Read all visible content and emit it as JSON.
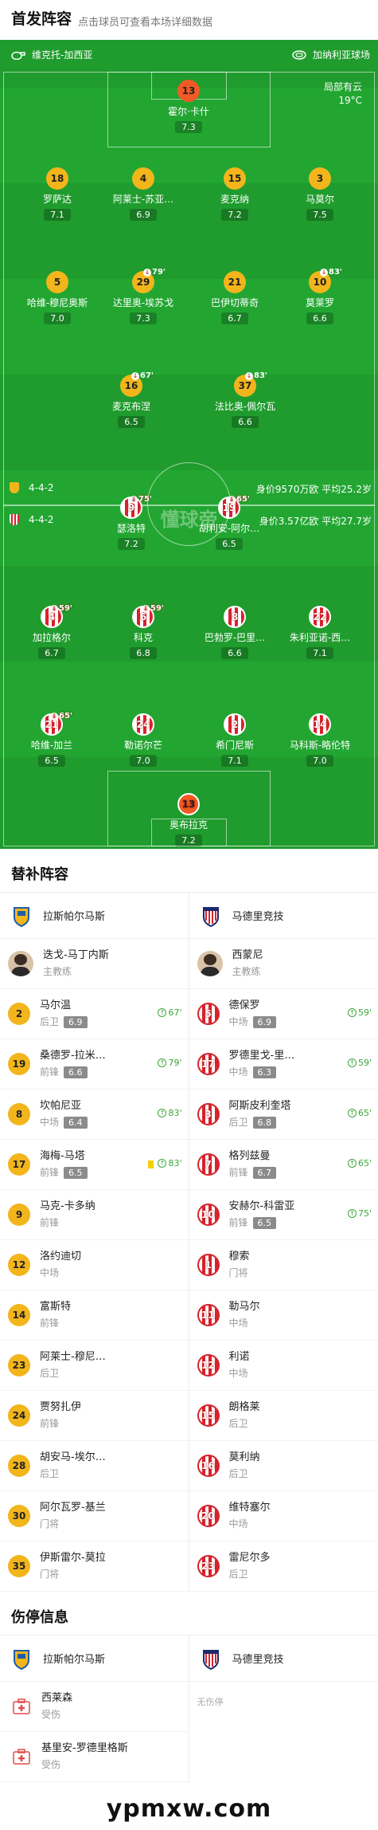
{
  "header": {
    "title": "首发阵容",
    "subtitle": "点击球员可查看本场详细数据"
  },
  "venue": {
    "home_team": "维克托-加西亚",
    "stadium": "加纳利亚球场",
    "weather": "局部有云",
    "temperature": "19°C"
  },
  "watermark": "懂球帝",
  "home_info": {
    "formation": "4-4-2",
    "value": "身价9570万欧",
    "avg_age": "平均25.2岁"
  },
  "away_info": {
    "formation": "4-4-2",
    "value": "身价3.57亿欧",
    "avg_age": "平均27.7岁"
  },
  "home_players": [
    {
      "num": "13",
      "name": "霍尔·卡什",
      "rating": "7.3"
    },
    {
      "num": "18",
      "name": "罗萨达",
      "rating": "7.1"
    },
    {
      "num": "4",
      "name": "阿莱士-苏亚…",
      "rating": "6.9"
    },
    {
      "num": "15",
      "name": "麦克纳",
      "rating": "7.2"
    },
    {
      "num": "3",
      "name": "马莫尔",
      "rating": "7.5"
    },
    {
      "num": "5",
      "name": "哈维-穆尼奥斯",
      "rating": "7.0"
    },
    {
      "num": "29",
      "name": "达里奥-埃苏戈",
      "rating": "7.3",
      "sub": "79'"
    },
    {
      "num": "21",
      "name": "巴伊切蒂奇",
      "rating": "6.7"
    },
    {
      "num": "10",
      "name": "莫莱罗",
      "rating": "6.6",
      "sub": "83'"
    },
    {
      "num": "16",
      "name": "麦克布涅",
      "rating": "6.5",
      "sub": "67'"
    },
    {
      "num": "37",
      "name": "法比奥-佩尔瓦",
      "rating": "6.6",
      "sub": "83'"
    }
  ],
  "away_players": [
    {
      "num": "9",
      "name": "瑟洛特",
      "rating": "7.2",
      "sub": "75'"
    },
    {
      "num": "19",
      "name": "胡利安-阿尔…",
      "rating": "6.5",
      "sub": "65'"
    },
    {
      "num": "4",
      "name": "加拉格尔",
      "rating": "6.7",
      "sub": "59'"
    },
    {
      "num": "6",
      "name": "科克",
      "rating": "6.8",
      "sub": "59'"
    },
    {
      "num": "8",
      "name": "巴勃罗-巴里…",
      "rating": "6.6"
    },
    {
      "num": "22",
      "name": "朱利亚诺-西…",
      "rating": "7.1"
    },
    {
      "num": "21",
      "name": "哈维-加兰",
      "rating": "6.5",
      "sub": "65'"
    },
    {
      "num": "24",
      "name": "勒诺尔芒",
      "rating": "7.0"
    },
    {
      "num": "2",
      "name": "希门尼斯",
      "rating": "7.1"
    },
    {
      "num": "14",
      "name": "马科斯-略伦特",
      "rating": "7.0"
    },
    {
      "num": "13",
      "name": "奥布拉克",
      "rating": "7.2"
    }
  ],
  "subs": {
    "title": "替补阵容",
    "home_team": "拉斯帕尔马斯",
    "away_team": "马德里竞技",
    "home_coach": {
      "name": "迭戈-马丁内斯",
      "role": "主教练"
    },
    "away_coach": {
      "name": "西蒙尼",
      "role": "主教练"
    },
    "home": [
      {
        "num": "2",
        "name": "马尔温",
        "pos": "后卫",
        "rating": "6.9",
        "in": "67'"
      },
      {
        "num": "19",
        "name": "桑德罗-拉米…",
        "pos": "前锋",
        "rating": "6.6",
        "in": "79'"
      },
      {
        "num": "8",
        "name": "坎帕尼亚",
        "pos": "中场",
        "rating": "6.4",
        "in": "83'"
      },
      {
        "num": "17",
        "name": "海梅-马塔",
        "pos": "前锋",
        "rating": "6.5",
        "in": "83'",
        "card": true
      },
      {
        "num": "9",
        "name": "马克-卡多纳",
        "pos": "前锋"
      },
      {
        "num": "12",
        "name": "洛约迪切",
        "pos": "中场"
      },
      {
        "num": "14",
        "name": "富斯特",
        "pos": "前锋"
      },
      {
        "num": "23",
        "name": "阿莱士-穆尼…",
        "pos": "后卫"
      },
      {
        "num": "24",
        "name": "贾努扎伊",
        "pos": "前锋"
      },
      {
        "num": "28",
        "name": "胡安马-埃尔…",
        "pos": "后卫"
      },
      {
        "num": "30",
        "name": "阿尔瓦罗-基兰",
        "pos": "门将"
      },
      {
        "num": "35",
        "name": "伊斯雷尔-莫拉",
        "pos": "门将"
      }
    ],
    "away": [
      {
        "num": "5",
        "name": "德保罗",
        "pos": "中场",
        "rating": "6.9",
        "in": "59'"
      },
      {
        "num": "17",
        "name": "罗德里戈-里…",
        "pos": "中场",
        "rating": "6.3",
        "in": "59'"
      },
      {
        "num": "3",
        "name": "阿斯皮利奎塔",
        "pos": "后卫",
        "rating": "6.8",
        "in": "65'"
      },
      {
        "num": "7",
        "name": "格列兹曼",
        "pos": "前锋",
        "rating": "6.7",
        "in": "65'"
      },
      {
        "num": "10",
        "name": "安赫尔-科雷亚",
        "pos": "前锋",
        "rating": "6.5",
        "in": "75'"
      },
      {
        "num": "1",
        "name": "穆索",
        "pos": "门将"
      },
      {
        "num": "11",
        "name": "勒马尔",
        "pos": "中场"
      },
      {
        "num": "12",
        "name": "利诺",
        "pos": "中场"
      },
      {
        "num": "15",
        "name": "朗格莱",
        "pos": "后卫"
      },
      {
        "num": "16",
        "name": "莫利纳",
        "pos": "后卫"
      },
      {
        "num": "20",
        "name": "维特塞尔",
        "pos": "中场"
      },
      {
        "num": "23",
        "name": "雷尼尔多",
        "pos": "后卫"
      }
    ]
  },
  "injuries": {
    "title": "伤停信息",
    "home_team": "拉斯帕尔马斯",
    "away_team": "马德里竞技",
    "home": [
      {
        "name": "西莱森",
        "status": "受伤"
      },
      {
        "name": "基里安-罗德里格斯",
        "status": "受伤"
      }
    ],
    "away_none": "无伤停"
  },
  "site_watermark": "ypmxw.com"
}
